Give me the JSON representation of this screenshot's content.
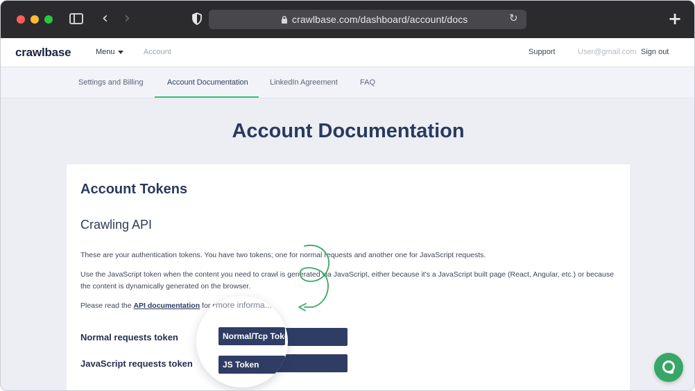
{
  "browser": {
    "url": "crawlbase.com/dashboard/account/docs",
    "icons": [
      "sidebar-icon",
      "back-icon",
      "forward-icon",
      "shield-icon",
      "lock-icon",
      "reload-icon",
      "plus-icon"
    ]
  },
  "header": {
    "logo": "crawlbase",
    "menu_label": "Menu",
    "account_label": "Account",
    "support_label": "Support",
    "user_email": "User@gmail.com",
    "signout_label": "Sign out"
  },
  "tabs": [
    {
      "label": "Settings and Billing",
      "active": false
    },
    {
      "label": "Account Documentation",
      "active": true
    },
    {
      "label": "LinkedIn Agreement",
      "active": false
    },
    {
      "label": "FAQ",
      "active": false
    }
  ],
  "page": {
    "title": "Account Documentation"
  },
  "card": {
    "title": "Account Tokens",
    "subtitle": "Crawling API",
    "para1": "These are your authentication tokens. You have two tokens; one for normal requests and another one for JavaScript requests.",
    "para2": "Use the JavaScript token when the content you need to crawl is generated via JavaScript, either because it's a JavaScript built page (React, Angular, etc.) or because the content is dynamically generated on the browser.",
    "para3_prefix": "Please read the ",
    "para3_link": "API documentation",
    "para3_suffix": " for more information.",
    "normal_token_label": "Normal requests token",
    "js_token_label": "JavaScript requests token",
    "normal_token_value": "Normal/Tcp Token",
    "js_token_value": "JS Token"
  },
  "magnifier": {
    "faded_text": "more informa..."
  },
  "colors": {
    "accent": "#3dbf73",
    "navy": "#2a3a5e",
    "token_bar": "#2f3d64",
    "chat": "#36a766"
  }
}
